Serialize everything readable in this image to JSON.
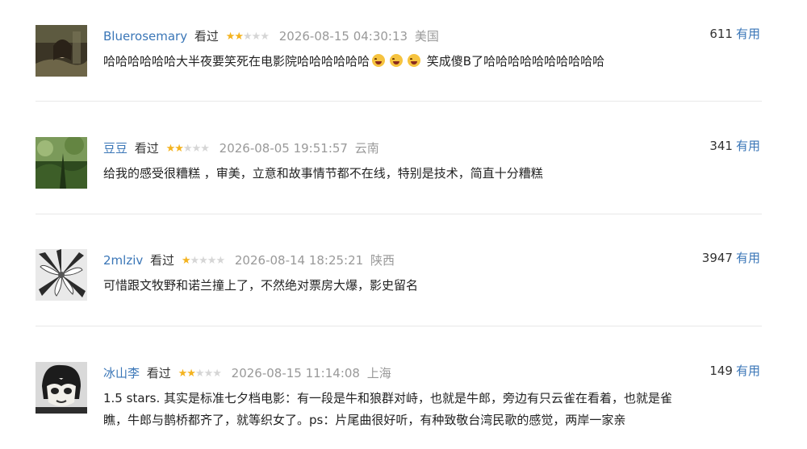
{
  "comments": [
    {
      "user": "Bluerosemary",
      "status": "看过",
      "rating": 2,
      "time": "2026-08-15 04:30:13",
      "location": "美国",
      "votes": "611",
      "useful_label": "有用",
      "text_a": "哈哈哈哈哈哈大半夜要笑死在电影院哈哈哈哈哈哈",
      "emojis": [
        "rolling-on-floor-laughing",
        "rolling-on-floor-laughing",
        "rolling-on-floor-laughing"
      ],
      "text_b": "笑成傻B了哈哈哈哈哈哈哈哈哈哈"
    },
    {
      "user": "豆豆",
      "status": "看过",
      "rating": 2,
      "time": "2026-08-05 19:51:57",
      "location": "云南",
      "votes": "341",
      "useful_label": "有用",
      "text": "给我的感受很糟糕 ，审美，立意和故事情节都不在线，特别是技术，简直十分糟糕"
    },
    {
      "user": "2mlziv",
      "status": "看过",
      "rating": 1,
      "time": "2026-08-14 18:25:21",
      "location": "陕西",
      "votes": "3947",
      "useful_label": "有用",
      "text": "可惜跟文牧野和诺兰撞上了，不然绝对票房大爆，影史留名"
    },
    {
      "user": "冰山李",
      "status": "看过",
      "rating": 2,
      "time": "2026-08-15 11:14:08",
      "location": "上海",
      "votes": "149",
      "useful_label": "有用",
      "text_line1": "1.5 stars. 其实是标准七夕档电影：有一段是牛和狼群对峙，也就是牛郎，旁边有只云雀在看着，也就是雀",
      "text_line2": "瞧，牛郎与鹊桥都齐了，就等织女了。ps：片尾曲很好听，有种致敬台湾民歌的感觉，两岸一家亲"
    }
  ]
}
